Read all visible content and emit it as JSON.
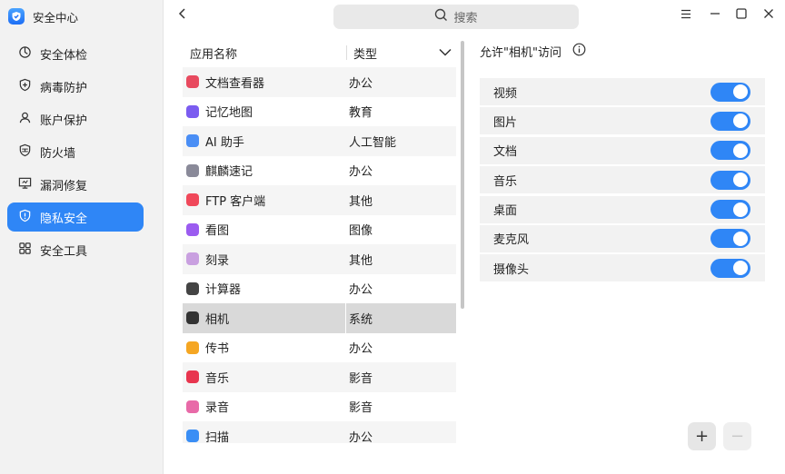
{
  "app": {
    "title": "安全中心"
  },
  "sidebar": {
    "items": [
      {
        "label": "安全体检",
        "icon": "scan-icon"
      },
      {
        "label": "病毒防护",
        "icon": "shield-plus-icon"
      },
      {
        "label": "账户保护",
        "icon": "user-icon"
      },
      {
        "label": "防火墙",
        "icon": "firewall-icon"
      },
      {
        "label": "漏洞修复",
        "icon": "monitor-icon"
      },
      {
        "label": "隐私安全",
        "icon": "privacy-shield-icon",
        "active": true
      },
      {
        "label": "安全工具",
        "icon": "grid-icon"
      }
    ]
  },
  "search": {
    "placeholder": "搜索"
  },
  "table": {
    "col_name": "应用名称",
    "col_type": "类型",
    "rows": [
      {
        "name": "文档查看器",
        "type": "办公",
        "color": "#e84a5f"
      },
      {
        "name": "记忆地图",
        "type": "教育",
        "color": "#7b5cf0"
      },
      {
        "name": "AI 助手",
        "type": "人工智能",
        "color": "#4a8ef5"
      },
      {
        "name": "麒麟速记",
        "type": "办公",
        "color": "#8a8a99"
      },
      {
        "name": "FTP 客户端",
        "type": "其他",
        "color": "#f0485a"
      },
      {
        "name": "看图",
        "type": "图像",
        "color": "#9b5cf0"
      },
      {
        "name": "刻录",
        "type": "其他",
        "color": "#c9a0e0"
      },
      {
        "name": "计算器",
        "type": "办公",
        "color": "#444444"
      },
      {
        "name": "相机",
        "type": "系统",
        "color": "#333333",
        "selected": true
      },
      {
        "name": "传书",
        "type": "办公",
        "color": "#f5a623"
      },
      {
        "name": "音乐",
        "type": "影音",
        "color": "#e8364f"
      },
      {
        "name": "录音",
        "type": "影音",
        "color": "#e86aa8"
      },
      {
        "name": "扫描",
        "type": "办公",
        "color": "#3a8ef5"
      }
    ]
  },
  "permissions": {
    "title": "允许\"相机\"访问",
    "items": [
      {
        "label": "视频",
        "enabled": true
      },
      {
        "label": "图片",
        "enabled": true
      },
      {
        "label": "文档",
        "enabled": true
      },
      {
        "label": "音乐",
        "enabled": true
      },
      {
        "label": "桌面",
        "enabled": true
      },
      {
        "label": "麦克风",
        "enabled": true
      },
      {
        "label": "摄像头",
        "enabled": true
      }
    ],
    "add_label": "+",
    "remove_label": "−"
  },
  "colors": {
    "accent": "#2f86f6"
  }
}
